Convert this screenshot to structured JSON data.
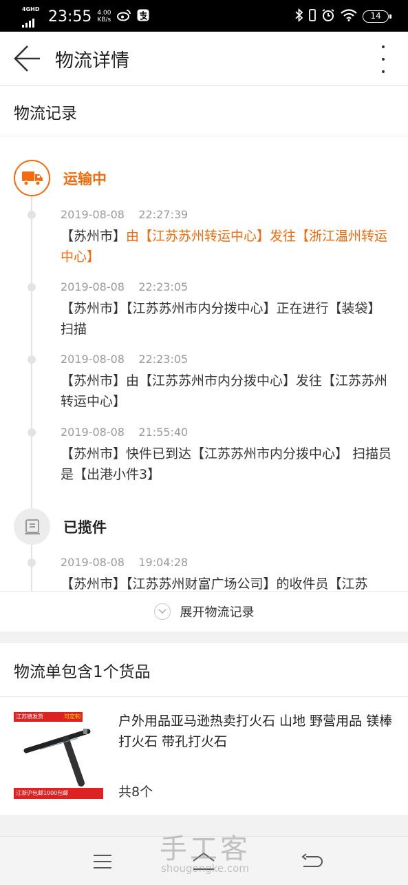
{
  "status_bar": {
    "network": "4GHD",
    "time": "23:55",
    "speed_value": "4.00",
    "speed_unit": "KB/s",
    "battery": "14"
  },
  "header": {
    "title": "物流详情"
  },
  "logistics": {
    "section_title": "物流记录",
    "statuses": [
      {
        "label": "运输中",
        "icon": "truck-icon",
        "events": [
          {
            "time": "2019-08-08    22:27:39",
            "city": "【苏州市】",
            "text": "由【江苏苏州转运中心】发往【浙江温州转运中心】"
          },
          {
            "time": "2019-08-08    22:23:05",
            "text": "【苏州市】【江苏苏州市内分拨中心】正在进行【装袋】扫描"
          },
          {
            "time": "2019-08-08    22:23:05",
            "text": "【苏州市】由【江苏苏州市内分拨中心】发往【江苏苏州转运中心】"
          },
          {
            "time": "2019-08-08    21:55:40",
            "text": "【苏州市】快件已到达【江苏苏州市内分拨中心】 扫描员是【出港小件3】"
          }
        ]
      },
      {
        "label": "已揽件",
        "icon": "package-icon",
        "events": [
          {
            "time": "2019-08-08    19:04:28",
            "text": "【苏州市】【江苏苏州财富广场公司】的收件员【江苏"
          }
        ]
      }
    ],
    "expand_label": "展开物流记录"
  },
  "goods": {
    "title": "物流单包含1个货品",
    "product": {
      "name": "户外用品亚马逊热卖打火石 山地 野营用品 镁棒打火石 带孔打火石",
      "quantity": "共8个",
      "image_tag_top": "江苏镇发货",
      "image_tag_top2": "可定制",
      "image_tag_bottom": "江浙沪包邮1000包邮"
    }
  },
  "watermark": {
    "main": "手工客",
    "url": "shougongke.com"
  },
  "colors": {
    "accent": "#f26b0c",
    "status_bar": "#000000",
    "background": "#f2f2f2"
  }
}
